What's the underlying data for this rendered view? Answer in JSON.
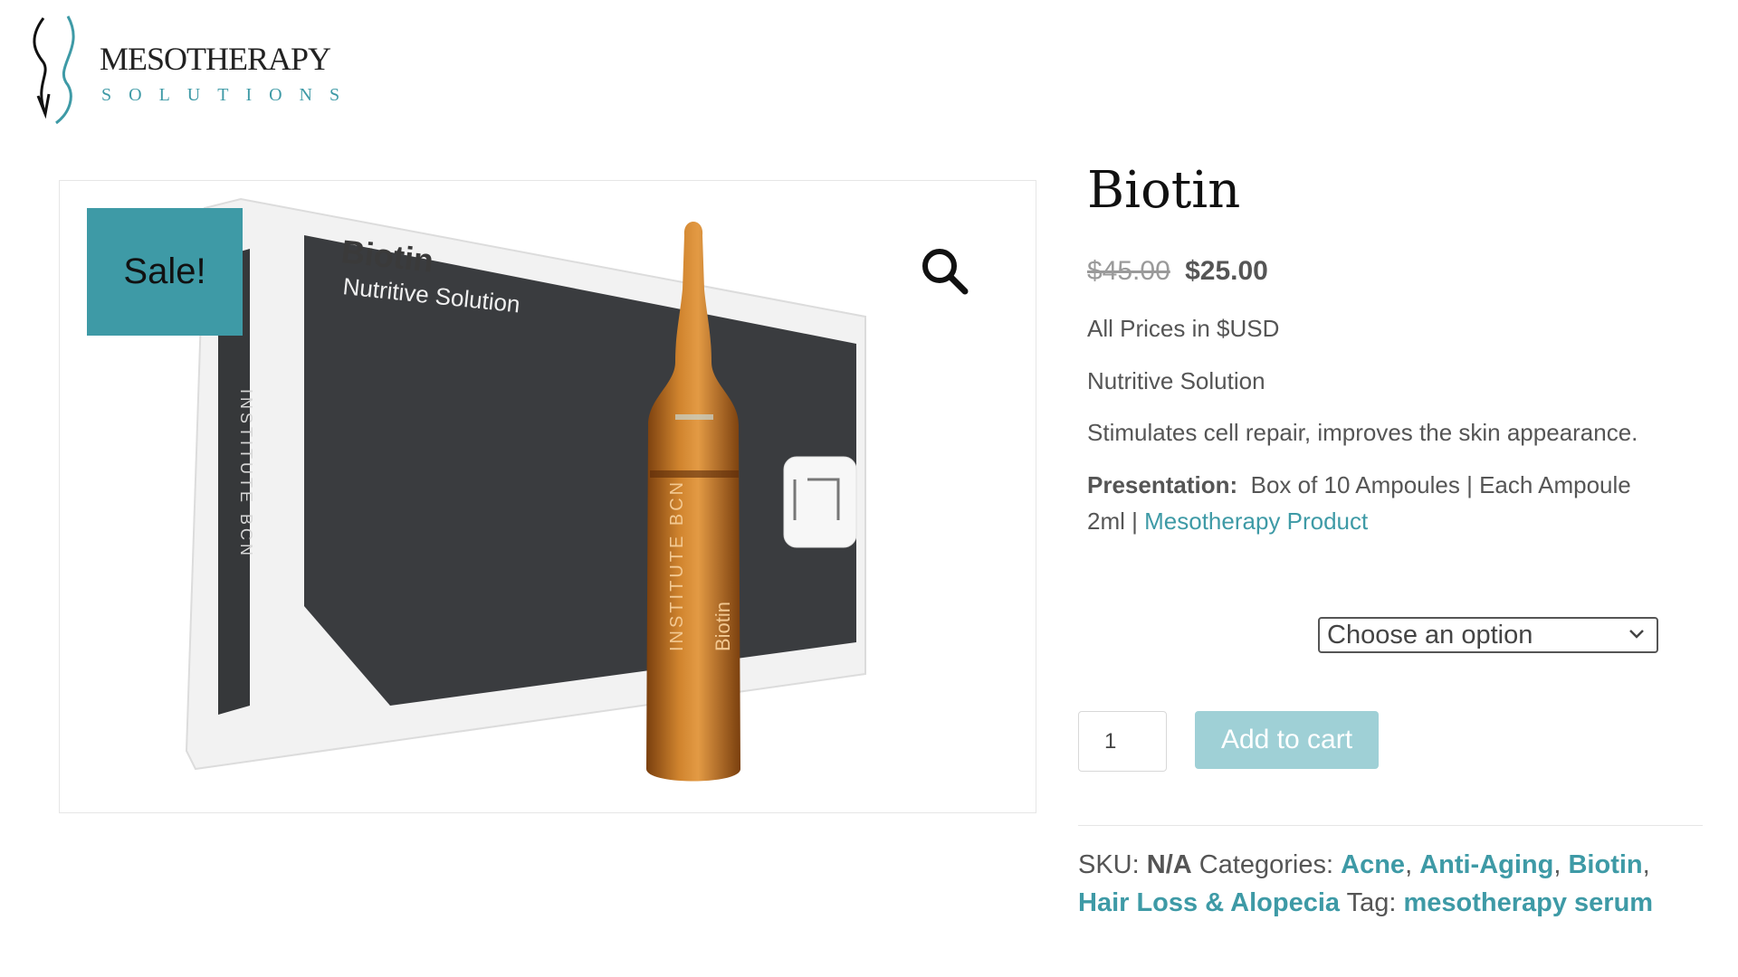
{
  "brand": {
    "name": "MESOTHERAPY",
    "sub": "SOLUTIONS"
  },
  "gallery": {
    "sale_badge": "Sale!",
    "box_title": "Biotin",
    "box_subtitle": "Nutritive Solution",
    "box_brand": "INSTITUTE BCN",
    "ampoule_label": "Biotin"
  },
  "product": {
    "title": "Biotin",
    "old_price": "$45.00",
    "price": "$25.00",
    "currency_note": "All Prices in $USD",
    "subtitle": "Nutritive Solution",
    "description": "Stimulates cell repair, improves the skin appearance.",
    "presentation_label": "Presentation:",
    "presentation_text": "Box of 10 Ampoules | Each Ampoule",
    "presentation_text2": "2ml |",
    "presentation_link": "Mesotherapy Product"
  },
  "form": {
    "select_value": "Choose an option",
    "quantity": "1",
    "add_to_cart": "Add to cart"
  },
  "meta": {
    "sku_label": "SKU:",
    "sku_value": "N/A",
    "categories_label": "Categories:",
    "categories": [
      "Acne",
      "Anti-Aging",
      "Biotin",
      "Hair Loss & Alopecia"
    ],
    "tag_label": "Tag:",
    "tag": "mesotherapy serum"
  },
  "colors": {
    "accent": "#3e9aa6",
    "button": "#9fd0d6"
  }
}
